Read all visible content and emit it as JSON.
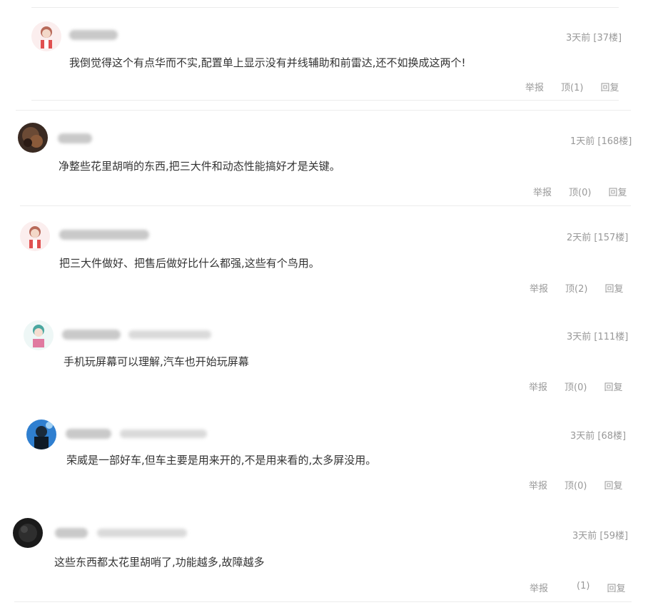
{
  "comments": [
    {
      "avatar": "girl-avatar-red",
      "meta": "3天前 [37楼]",
      "text": "我倒觉得这个有点华而不实,配置单上显示没有并线辅助和前雷达,还不如换成这两个!",
      "report": "举报",
      "up": "顶(1)",
      "reply": "回复"
    },
    {
      "avatar": "photo-avatar-dark-brown",
      "meta": "1天前 [168楼]",
      "text": "净整些花里胡哨的东西,把三大件和动态性能搞好才是关键。",
      "report": "举报",
      "up": "顶(0)",
      "reply": "回复"
    },
    {
      "avatar": "girl-avatar-red",
      "meta": "2天前 [157楼]",
      "text": "把三大件做好、把售后做好比什么都强,这些有个鸟用。",
      "report": "举报",
      "up": "顶(2)",
      "reply": "回复"
    },
    {
      "avatar": "girl-avatar-teal",
      "meta": "3天前 [111楼]",
      "text": "手机玩屏幕可以理解,汽车也开始玩屏幕",
      "report": "举报",
      "up": "顶(0)",
      "reply": "回复"
    },
    {
      "avatar": "photo-avatar-blue",
      "meta": "3天前 [68楼]",
      "text": "荣威是一部好车,但车主要是用来开的,不是用来看的,太多屏没用。",
      "report": "举报",
      "up": "顶(0)",
      "reply": "回复"
    },
    {
      "avatar": "photo-avatar-black",
      "meta": "3天前 [59楼]",
      "text": "这些东西都太花里胡哨了,功能越多,故障越多",
      "report": "举报",
      "up": "(1)",
      "reply": "回复"
    }
  ]
}
